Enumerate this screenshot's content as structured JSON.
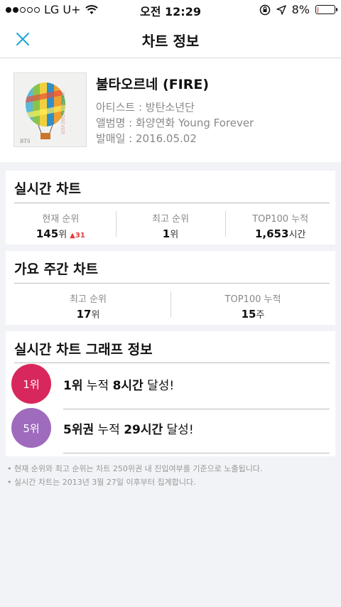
{
  "status_bar": {
    "carrier": "LG U+",
    "time": "오전 12:29",
    "battery": "8%",
    "battery_level": 0.08
  },
  "nav": {
    "title": "차트 정보"
  },
  "song": {
    "title": "불타오르네 (FIRE)",
    "artist": "아티스트 : 방탄소년단",
    "album": "앨범명 : 화양연화 Young Forever",
    "release": "발매일 : 2016.05.02"
  },
  "realtime_chart": {
    "title": "실시간 차트",
    "current": {
      "label": "현재 순위",
      "value": "145",
      "unit": "위",
      "change": "31"
    },
    "best": {
      "label": "최고 순위",
      "value": "1",
      "unit": "위"
    },
    "top100": {
      "label": "TOP100 누적",
      "value": "1,653",
      "unit": "시간"
    }
  },
  "weekly_chart": {
    "title": "가요 주간 차트",
    "best": {
      "label": "최고 순위",
      "value": "17",
      "unit": "위"
    },
    "top100": {
      "label": "TOP100 누적",
      "value": "15",
      "unit": "주"
    }
  },
  "graph": {
    "title": "실시간 차트 그래프 정보",
    "items": [
      {
        "badge": "1위",
        "rank": "1위",
        "mid": " 누적 ",
        "hours": "8시간",
        "end": " 달성!",
        "color": "#d8275c"
      },
      {
        "badge": "5위",
        "rank": "5위권",
        "mid": " 누적 ",
        "hours": "29시간",
        "end": " 달성!",
        "color": "#9e6bbd"
      }
    ]
  },
  "notes": [
    "• 현재 순위와 최고 순위는 차트 250위권 내 진입여부를 기준으로 노출됩니다.",
    "• 실시간 차트는 2013년 3월 27일 이후부터 집계합니다."
  ]
}
